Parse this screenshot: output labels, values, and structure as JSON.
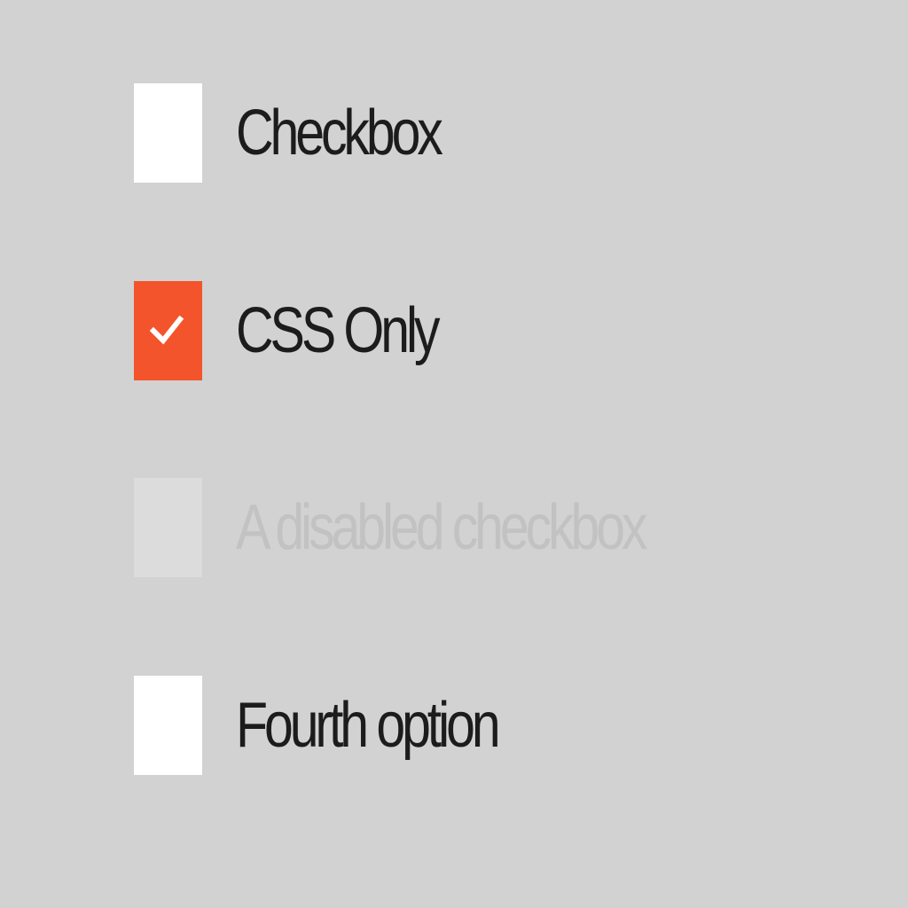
{
  "colors": {
    "background": "#d2d2d2",
    "box_unchecked": "#ffffff",
    "box_checked": "#f4542b",
    "box_disabled": "#dcdcdc",
    "label_text": "#1c1c1c",
    "label_disabled": "#c2c2c2",
    "checkmark": "#ffffff"
  },
  "options": [
    {
      "label": "Checkbox",
      "checked": false,
      "disabled": false
    },
    {
      "label": "CSS Only",
      "checked": true,
      "disabled": false,
      "icon": "checkmark-icon"
    },
    {
      "label": "A disabled checkbox",
      "checked": false,
      "disabled": true
    },
    {
      "label": "Fourth option",
      "checked": false,
      "disabled": false
    }
  ]
}
